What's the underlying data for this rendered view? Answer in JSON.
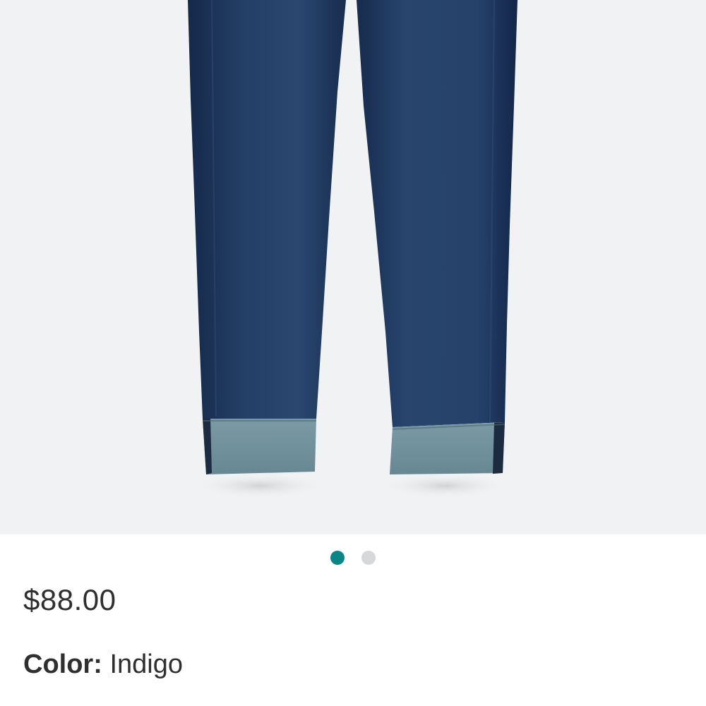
{
  "product": {
    "image_icon": "jeans-image",
    "price": "$88.00",
    "color_label": "Color:",
    "color_value": "Indigo"
  },
  "carousel": {
    "page_count": 2,
    "active_index": 0,
    "active_color": "#0a8686",
    "inactive_color": "#d6d8da"
  },
  "colors": {
    "image_background": "#f1f2f3",
    "denim_dark": "#1f3a5c",
    "denim_cuff": "#6f909c"
  }
}
